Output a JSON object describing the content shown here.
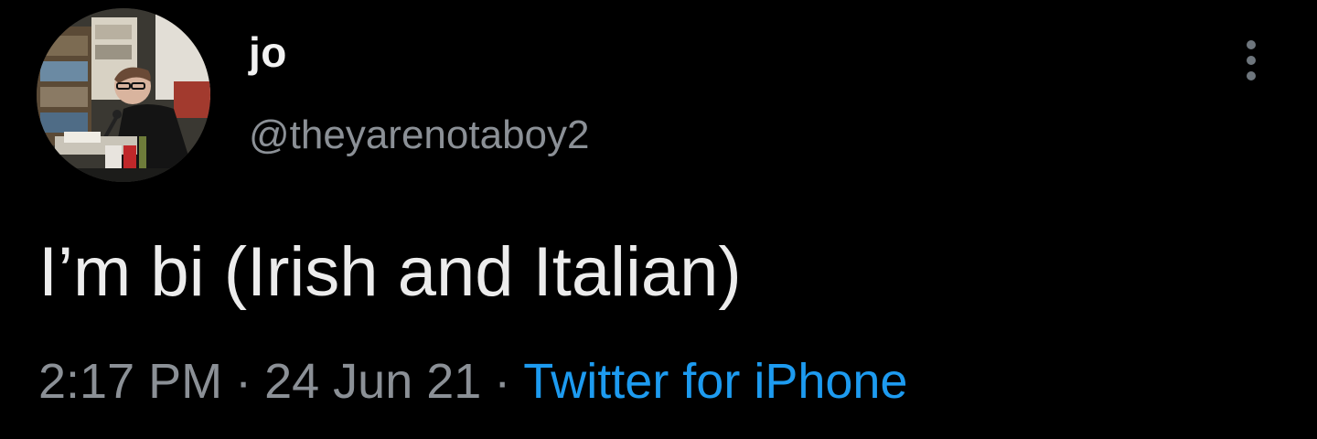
{
  "tweet": {
    "author": {
      "display_name": "jo",
      "handle": "@theyarenotaboy2"
    },
    "text": "I’m bi (Irish and Italian)",
    "meta": {
      "time": "2:17 PM",
      "separator": "·",
      "date": "24 Jun 21",
      "source": "Twitter for iPhone"
    },
    "more_icon": "more-vertical-icon"
  },
  "colors": {
    "background": "#000000",
    "text_primary": "#ececec",
    "text_secondary": "#8b9096",
    "link": "#1d9bf0"
  }
}
